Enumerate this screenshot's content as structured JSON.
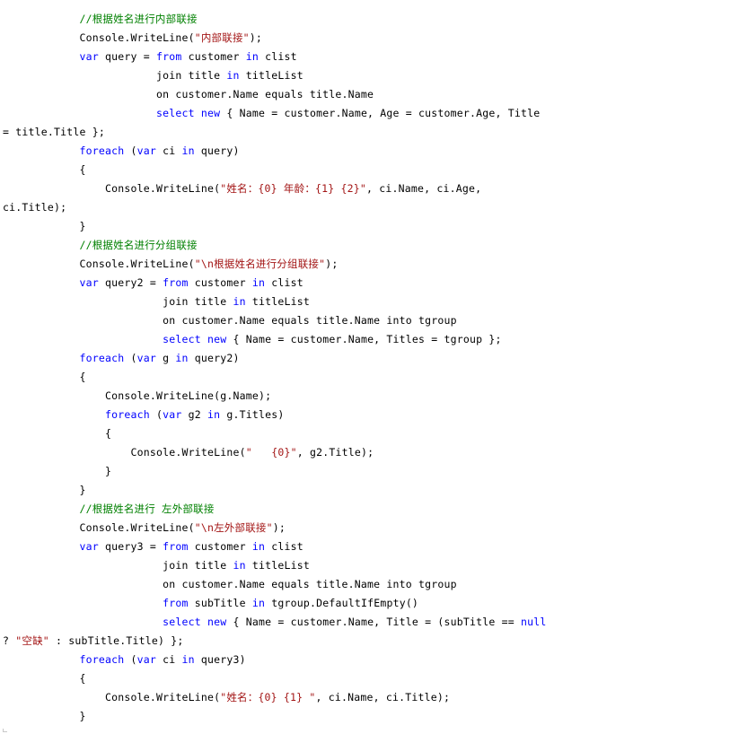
{
  "code": {
    "language": "C#",
    "colors": {
      "keyword": "#0000ff",
      "comment": "#008000",
      "string": "#a31515",
      "plain": "#000000"
    },
    "lines": [
      [
        {
          "t": "            "
        },
        {
          "t": "//根据姓名进行内部联接",
          "k": "comment"
        }
      ],
      [
        {
          "t": "            Console.WriteLine("
        },
        {
          "t": "\"内部联接\"",
          "k": "string"
        },
        {
          "t": ");"
        }
      ],
      [
        {
          "t": "            "
        },
        {
          "t": "var",
          "k": "keyword"
        },
        {
          "t": " query = "
        },
        {
          "t": "from",
          "k": "keyword"
        },
        {
          "t": " customer "
        },
        {
          "t": "in",
          "k": "keyword"
        },
        {
          "t": " clist"
        }
      ],
      [
        {
          "t": "                        join title "
        },
        {
          "t": "in",
          "k": "keyword"
        },
        {
          "t": " titleList"
        }
      ],
      [
        {
          "t": "                        on customer.Name equals title.Name"
        }
      ],
      [
        {
          "t": "                        "
        },
        {
          "t": "select",
          "k": "keyword"
        },
        {
          "t": " "
        },
        {
          "t": "new",
          "k": "keyword"
        },
        {
          "t": " { Name = customer.Name, Age = customer.Age, Title"
        }
      ],
      [
        {
          "t": "= title.Title };"
        }
      ],
      [
        {
          "t": "            "
        },
        {
          "t": "foreach",
          "k": "keyword"
        },
        {
          "t": " ("
        },
        {
          "t": "var",
          "k": "keyword"
        },
        {
          "t": " ci "
        },
        {
          "t": "in",
          "k": "keyword"
        },
        {
          "t": " query)"
        }
      ],
      [
        {
          "t": "            {"
        }
      ],
      [
        {
          "t": "                Console.WriteLine("
        },
        {
          "t": "\"姓名：{0} 年龄：{1} {2}\"",
          "k": "string"
        },
        {
          "t": ", ci.Name, ci.Age,"
        }
      ],
      [
        {
          "t": "ci.Title);"
        }
      ],
      [
        {
          "t": "            }"
        }
      ],
      [
        {
          "t": "            "
        },
        {
          "t": "//根据姓名进行分组联接",
          "k": "comment"
        }
      ],
      [
        {
          "t": "            Console.WriteLine("
        },
        {
          "t": "\"\\n根据姓名进行分组联接\"",
          "k": "string"
        },
        {
          "t": ");"
        }
      ],
      [
        {
          "t": "            "
        },
        {
          "t": "var",
          "k": "keyword"
        },
        {
          "t": " query2 = "
        },
        {
          "t": "from",
          "k": "keyword"
        },
        {
          "t": " customer "
        },
        {
          "t": "in",
          "k": "keyword"
        },
        {
          "t": " clist"
        }
      ],
      [
        {
          "t": "                         join title "
        },
        {
          "t": "in",
          "k": "keyword"
        },
        {
          "t": " titleList"
        }
      ],
      [
        {
          "t": "                         on customer.Name equals title.Name into tgroup"
        }
      ],
      [
        {
          "t": "                         "
        },
        {
          "t": "select",
          "k": "keyword"
        },
        {
          "t": " "
        },
        {
          "t": "new",
          "k": "keyword"
        },
        {
          "t": " { Name = customer.Name, Titles = tgroup };"
        }
      ],
      [
        {
          "t": "            "
        },
        {
          "t": "foreach",
          "k": "keyword"
        },
        {
          "t": " ("
        },
        {
          "t": "var",
          "k": "keyword"
        },
        {
          "t": " g "
        },
        {
          "t": "in",
          "k": "keyword"
        },
        {
          "t": " query2)"
        }
      ],
      [
        {
          "t": "            {"
        }
      ],
      [
        {
          "t": "                Console.WriteLine(g.Name);"
        }
      ],
      [
        {
          "t": "                "
        },
        {
          "t": "foreach",
          "k": "keyword"
        },
        {
          "t": " ("
        },
        {
          "t": "var",
          "k": "keyword"
        },
        {
          "t": " g2 "
        },
        {
          "t": "in",
          "k": "keyword"
        },
        {
          "t": " g.Titles)"
        }
      ],
      [
        {
          "t": "                {"
        }
      ],
      [
        {
          "t": "                    Console.WriteLine("
        },
        {
          "t": "\"   {0}\"",
          "k": "string"
        },
        {
          "t": ", g2.Title);"
        }
      ],
      [
        {
          "t": "                }"
        }
      ],
      [
        {
          "t": "            }"
        }
      ],
      [
        {
          "t": "            "
        },
        {
          "t": "//根据姓名进行 左外部联接",
          "k": "comment"
        }
      ],
      [
        {
          "t": "            Console.WriteLine("
        },
        {
          "t": "\"\\n左外部联接\"",
          "k": "string"
        },
        {
          "t": ");"
        }
      ],
      [
        {
          "t": "            "
        },
        {
          "t": "var",
          "k": "keyword"
        },
        {
          "t": " query3 = "
        },
        {
          "t": "from",
          "k": "keyword"
        },
        {
          "t": " customer "
        },
        {
          "t": "in",
          "k": "keyword"
        },
        {
          "t": " clist"
        }
      ],
      [
        {
          "t": "                         join title "
        },
        {
          "t": "in",
          "k": "keyword"
        },
        {
          "t": " titleList"
        }
      ],
      [
        {
          "t": "                         on customer.Name equals title.Name into tgroup"
        }
      ],
      [
        {
          "t": "                         "
        },
        {
          "t": "from",
          "k": "keyword"
        },
        {
          "t": " subTitle "
        },
        {
          "t": "in",
          "k": "keyword"
        },
        {
          "t": " tgroup.DefaultIfEmpty()"
        }
      ],
      [
        {
          "t": "                         "
        },
        {
          "t": "select",
          "k": "keyword"
        },
        {
          "t": " "
        },
        {
          "t": "new",
          "k": "keyword"
        },
        {
          "t": " { Name = customer.Name, Title = (subTitle == "
        },
        {
          "t": "null",
          "k": "keyword"
        }
      ],
      [
        {
          "t": "? "
        },
        {
          "t": "\"空缺\"",
          "k": "string"
        },
        {
          "t": " : subTitle.Title) };"
        }
      ],
      [
        {
          "t": "            "
        },
        {
          "t": "foreach",
          "k": "keyword"
        },
        {
          "t": " ("
        },
        {
          "t": "var",
          "k": "keyword"
        },
        {
          "t": " ci "
        },
        {
          "t": "in",
          "k": "keyword"
        },
        {
          "t": " query3)"
        }
      ],
      [
        {
          "t": "            {"
        }
      ],
      [
        {
          "t": "                Console.WriteLine("
        },
        {
          "t": "\"姓名：{0} {1} \"",
          "k": "string"
        },
        {
          "t": ", ci.Name, ci.Title);"
        }
      ],
      [
        {
          "t": "            }"
        }
      ]
    ]
  }
}
